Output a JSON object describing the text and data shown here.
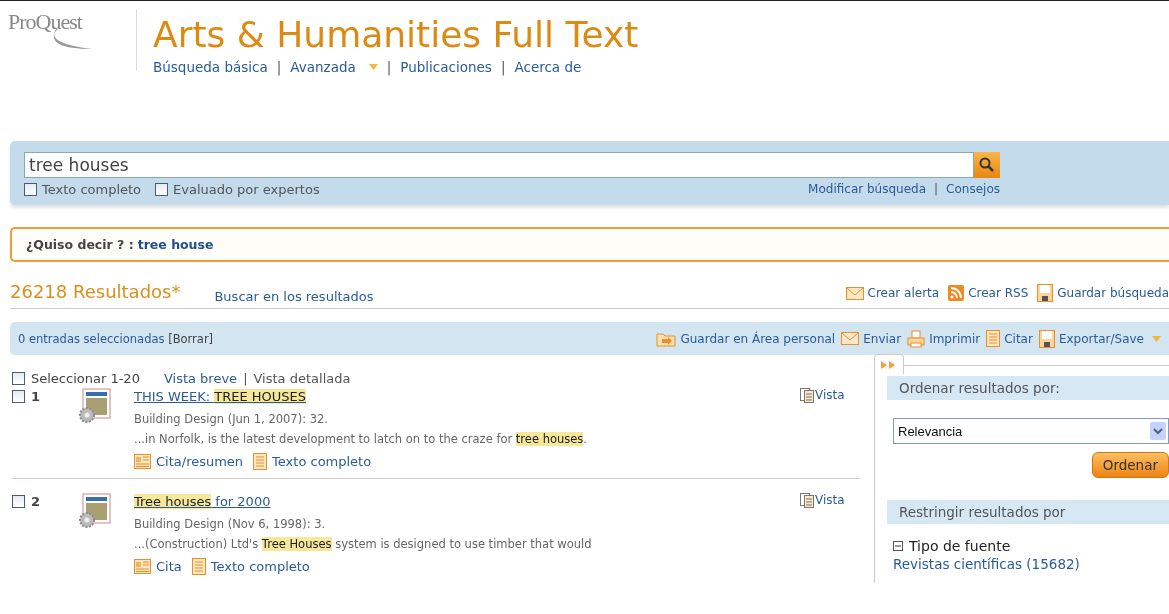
{
  "header": {
    "logo": "ProQuest",
    "title": "Arts & Humanities Full Text",
    "separator": "|",
    "nav": [
      {
        "label": "Búsqueda básica",
        "dropdown": false
      },
      {
        "label": "Avanzada",
        "dropdown": true
      },
      {
        "label": "Publicaciones",
        "dropdown": false
      },
      {
        "label": "Acerca de",
        "dropdown": false
      }
    ]
  },
  "search": {
    "value": "tree houses",
    "options": [
      {
        "label": "Texto completo",
        "checked": false
      },
      {
        "label": "Evaluado por expertos",
        "checked": false
      }
    ],
    "separator": "|",
    "links": [
      "Modificar búsqueda",
      "Consejos"
    ]
  },
  "suggestion": {
    "label": "¿Quiso decir ? :",
    "term": "tree house"
  },
  "results_header": {
    "count": "26218 Resultados*",
    "search_within": "Buscar en los resultados",
    "actions": [
      {
        "kind": "mail",
        "label": "Crear alerta"
      },
      {
        "kind": "rss",
        "label": "Crear RSS"
      },
      {
        "kind": "disk",
        "label": "Guardar búsqueda"
      }
    ]
  },
  "toolbar": {
    "selected_count": "0 entradas seleccionadas",
    "clear": "[Borrar]",
    "actions": [
      {
        "kind": "folder",
        "label": "Guardar en Área personal",
        "dropdown": false
      },
      {
        "kind": "mail",
        "label": "Enviar",
        "dropdown": false
      },
      {
        "kind": "printer",
        "label": "Imprimir",
        "dropdown": false
      },
      {
        "kind": "doc",
        "label": "Citar",
        "dropdown": false
      },
      {
        "kind": "disk",
        "label": "Exportar/Save",
        "dropdown": true
      }
    ]
  },
  "list_controls": {
    "select_all": {
      "label": "Seleccionar 1-20",
      "checked": false
    },
    "separator": "|",
    "views": [
      {
        "label": "Vista breve",
        "selected": false
      },
      {
        "label": "Vista detallada",
        "selected": true
      }
    ]
  },
  "results": [
    {
      "number": "1",
      "checked": false,
      "title": [
        {
          "text": "THIS WEEK: ",
          "highlighted": false
        },
        {
          "text": "TREE HOUSES",
          "highlighted": true
        }
      ],
      "source": "Building Design (Jun 1, 2007): 32.",
      "snippet": [
        {
          "text": "...in Norfolk, is the latest development to latch on to the craze for ",
          "highlighted": false
        },
        {
          "text": "tree houses",
          "highlighted": true
        },
        {
          "text": ".",
          "highlighted": false
        }
      ],
      "links": [
        {
          "kind": "abstract",
          "label": "Cita/resumen"
        },
        {
          "kind": "fulltext",
          "label": "Texto completo"
        }
      ],
      "preview": "Vista"
    },
    {
      "number": "2",
      "checked": false,
      "title": [
        {
          "text": "Tree houses",
          "highlighted": true
        },
        {
          "text": " for 2000",
          "highlighted": false
        }
      ],
      "source": "Building Design (Nov 6, 1998): 3.",
      "snippet": [
        {
          "text": "...(Construction) Ltd's ",
          "highlighted": false
        },
        {
          "text": "Tree Houses",
          "highlighted": true
        },
        {
          "text": " system is designed to use timber that would",
          "highlighted": false
        }
      ],
      "links": [
        {
          "kind": "abstract",
          "label": "Cita"
        },
        {
          "kind": "fulltext",
          "label": "Texto completo"
        }
      ],
      "preview": "Vista"
    }
  ],
  "sidebar": {
    "sort_heading": "Ordenar resultados por:",
    "sort_value": "Relevancia",
    "sort_button": "Ordenar",
    "filter_heading": "Restringir resultados por",
    "facets": [
      {
        "label": "Tipo de fuente",
        "expanded": true,
        "options": [
          "Revistas científicas (15682)"
        ]
      }
    ]
  }
}
